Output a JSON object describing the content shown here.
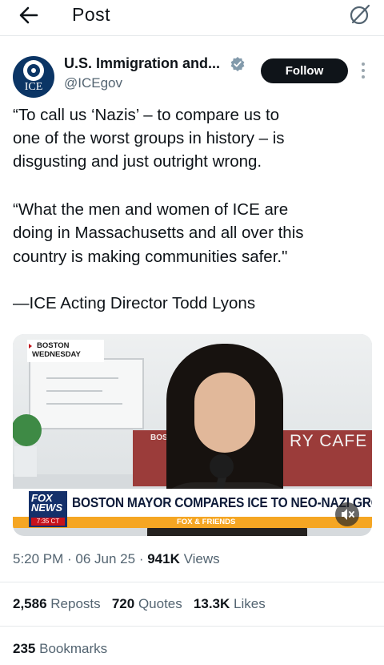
{
  "header": {
    "title": "Post",
    "back_icon": "back-arrow-icon",
    "grok_icon": "slashed-circle-icon"
  },
  "author": {
    "display_name": "U.S. Immigration and...",
    "handle": "@ICEgov",
    "avatar_text": "ICE",
    "verified": "verified-badge-icon",
    "follow_label": "Follow"
  },
  "post": {
    "lines": [
      "“To call us ‘Nazis’ – to compare us to",
      "one of the worst groups in history – is",
      "disgusting and just outright wrong.",
      "",
      "“What the men and women of ICE are",
      "doing in Massachusetts and all over this",
      "country is making communities safer.\"",
      "",
      "—ICE Acting Director Todd Lyons"
    ]
  },
  "media": {
    "tag_line1": "BOSTON",
    "tag_line2": "WEDNESDAY",
    "bg_sign": "BOS",
    "bg_cafe": "RY CAFE",
    "fox_logo": "FOX NEWS",
    "fox_time": "7:35 CT",
    "chyron": "BOSTON MAYOR COMPARES ICE TO NEO-NAZI GROUP",
    "band": "FOX & FRIENDS"
  },
  "meta": {
    "time": "5:20 PM",
    "date": "06 Jun 25",
    "views_count": "941K",
    "views_label": "Views"
  },
  "stats": {
    "reposts_count": "2,586",
    "reposts_label": "Reposts",
    "quotes_count": "720",
    "quotes_label": "Quotes",
    "likes_count": "13.3K",
    "likes_label": "Likes",
    "bookmarks_count": "235",
    "bookmarks_label": "Bookmarks"
  },
  "colors": {
    "text": "#0f1419",
    "secondary": "#536471",
    "verified": "#829aab",
    "follow_bg": "#0f1419"
  }
}
